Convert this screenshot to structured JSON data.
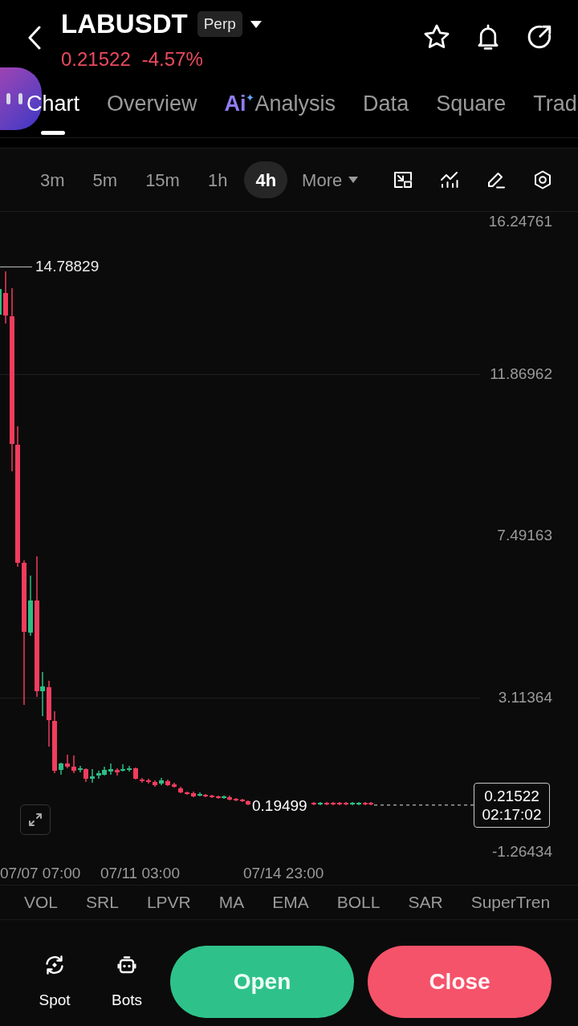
{
  "header": {
    "symbol": "LABUSDT",
    "contract_type": "Perp",
    "last_price": "0.21522",
    "change": "-4.57%"
  },
  "tabs": [
    {
      "label": "Chart",
      "selected": true
    },
    {
      "label": "Overview",
      "selected": false
    },
    {
      "label": "Analysis",
      "badge": "Ai",
      "selected": false
    },
    {
      "label": "Data",
      "selected": false
    },
    {
      "label": "Square",
      "selected": false
    },
    {
      "label": "Trad",
      "selected": false
    }
  ],
  "toolbar": {
    "intervals": [
      {
        "label": "3m",
        "selected": false
      },
      {
        "label": "5m",
        "selected": false
      },
      {
        "label": "15m",
        "selected": false
      },
      {
        "label": "1h",
        "selected": false
      },
      {
        "label": "4h",
        "selected": true
      }
    ],
    "more": "More"
  },
  "chart": {
    "price_axis": [
      "16.24761",
      "11.86962",
      "7.49163",
      "3.11364",
      "-1.26434"
    ],
    "time_axis": [
      "07/07 07:00",
      "07/11 03:00",
      "07/14 23:00"
    ],
    "high_label": "14.78829",
    "low_label": "0.19499",
    "last_price": "0.21522",
    "countdown": "02:17:02"
  },
  "indicators": [
    "VOL",
    "SRL",
    "LPVR",
    "MA",
    "EMA",
    "BOLL",
    "SAR",
    "SuperTren"
  ],
  "bottom_bar": {
    "shortcuts": [
      "Spot",
      "Bots"
    ],
    "actions": [
      {
        "label": "Open",
        "kind": "buy"
      },
      {
        "label": "Close",
        "kind": "sell"
      }
    ]
  }
}
